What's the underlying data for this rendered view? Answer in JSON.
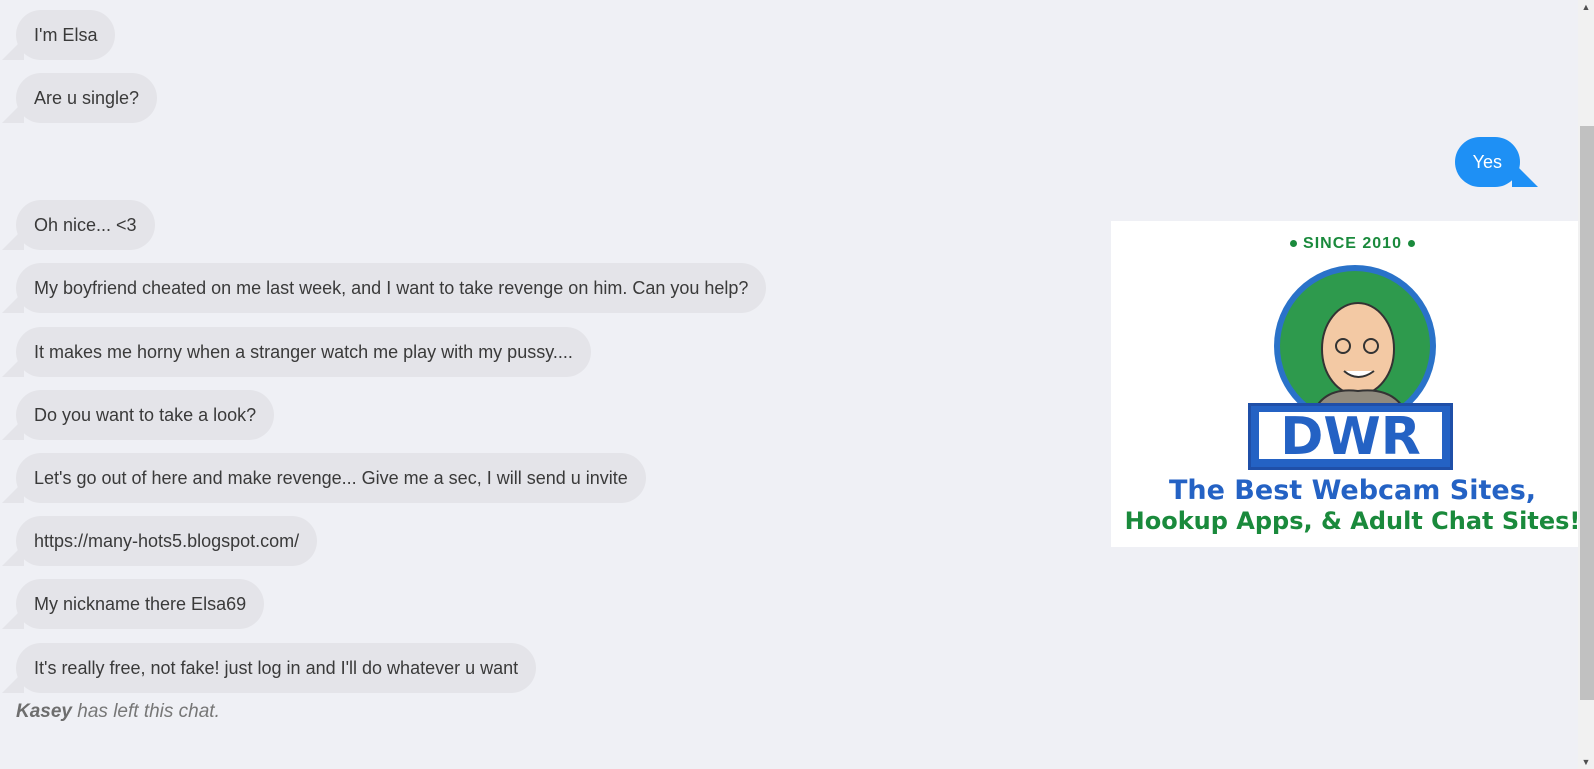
{
  "messages_in": [
    "I'm Elsa",
    "Are u single?",
    "Oh nice... <3",
    "My boyfriend cheated on me last week, and I want to take revenge on him. Can you help?",
    "It makes me horny when a stranger watch me play with my pussy....",
    "Do you want to take a look?",
    "Let's go out of here and make revenge... Give me a sec, I will send u invite",
    "https://many-hots5.blogspot.com/",
    "My nickname there Elsa69",
    "It's really free, not fake! just log in and I'll do whatever u want"
  ],
  "message_out": "Yes",
  "system_note": {
    "name": "Kasey",
    "text": "has left this chat."
  },
  "ad": {
    "since": "SINCE 2010",
    "logo": "DWR",
    "line1": "The Best Webcam Sites,",
    "line2": "Hookup Apps, & Adult Chat Sites!"
  },
  "colors": {
    "outgoing": "#1e90f5",
    "incoming": "#e4e4e9",
    "background": "#eff0f5"
  },
  "icons": {
    "scroll_up": "chevron-up-icon",
    "scroll_down": "chevron-down-icon"
  }
}
